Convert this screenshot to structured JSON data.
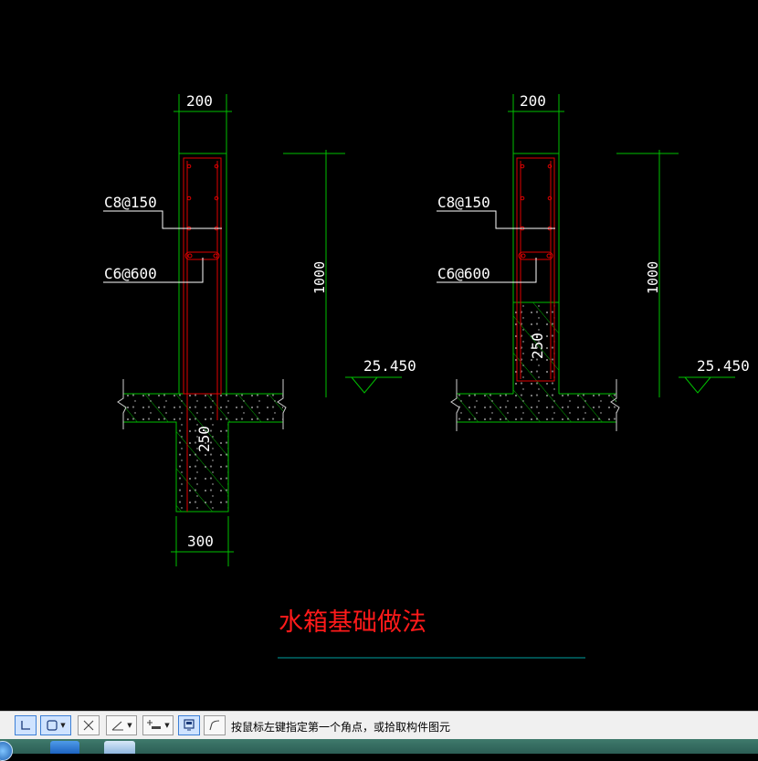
{
  "drawing": {
    "left_detail": {
      "top_dimension": "200",
      "bottom_dimension": "300",
      "rebar_label_1": "C8@150",
      "rebar_label_2": "C6@600",
      "height_dimension": "1000",
      "elevation": "25.450",
      "section_depth": "250"
    },
    "right_detail": {
      "top_dimension": "200",
      "rebar_label_1": "C8@150",
      "rebar_label_2": "C6@600",
      "height_dimension": "1000",
      "elevation": "25.450",
      "section_depth": "250"
    },
    "title": "水箱基础做法"
  },
  "colors": {
    "background": "#000000",
    "outline": "#00c000",
    "rebar": "#e00000",
    "dimension": "#00c000",
    "text": "#ffffff",
    "title": "#ff1a1a",
    "title_underline": "#00a0a0"
  },
  "statusbar": {
    "prompt": "按鼠标左键指定第一个角点，或拾取构件图元",
    "buttons": [
      {
        "name": "ortho-icon"
      },
      {
        "name": "rect-select-icon"
      },
      {
        "name": "cross-select-icon"
      },
      {
        "name": "angle-snap-icon"
      },
      {
        "name": "offset-icon"
      },
      {
        "name": "object-snap-icon"
      },
      {
        "name": "polyline-icon"
      }
    ]
  }
}
